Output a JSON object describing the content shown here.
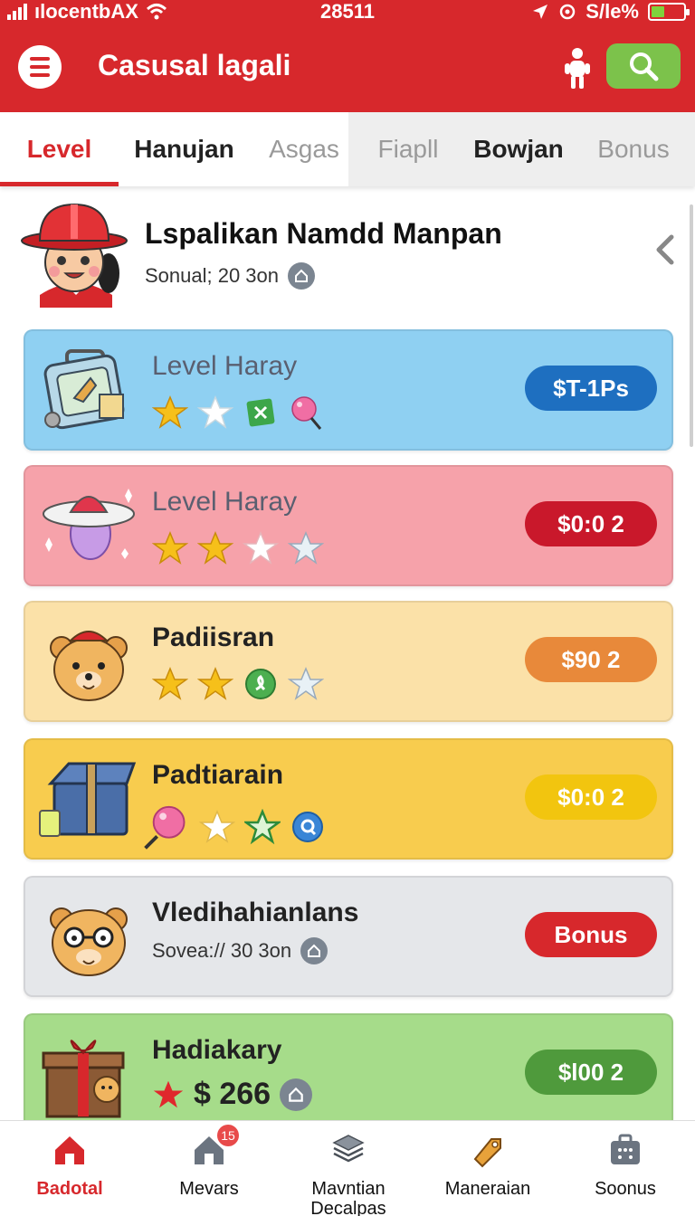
{
  "status_bar": {
    "carrier": "ılocentbAX",
    "time": "28511",
    "battery_text": "S/le%"
  },
  "header": {
    "title": "Casusal lagali",
    "menu_icon": "hamburger-menu-icon",
    "user_icon": "person-icon",
    "search_icon": "search-icon"
  },
  "tabs": [
    {
      "label": "Level",
      "active": true
    },
    {
      "label": "Hanujan",
      "active": false
    },
    {
      "label": "Asgas",
      "active": false
    },
    {
      "label": "Fiapll",
      "active": false
    },
    {
      "label": "Bowjan",
      "active": false
    },
    {
      "label": "Bonus",
      "active": false
    }
  ],
  "profile": {
    "name": "Lspalikan Namdd Manpan",
    "sub": "Sonual; 20 3on"
  },
  "cards": [
    {
      "title": "Level Haray",
      "price": "$T-1Ps",
      "bg": "#8fd0f2",
      "price_color": "#1e6fc0"
    },
    {
      "title": "Level Haray",
      "price": "$0:0 2",
      "bg": "#f6a2aa",
      "price_color": "#c9182b"
    },
    {
      "title": "Padiisran",
      "price": "$90 2",
      "bg": "#fbe1a8",
      "price_color": "#e8893a"
    },
    {
      "title": "Padtiarain",
      "price": "$0:0 2",
      "bg": "#f8cc4e",
      "price_color": "#f2c50f"
    },
    {
      "title": "Vledihahianlans",
      "sub": "Sovea:// 30 3on",
      "price": "Bonus",
      "bg": "#e5e7ea",
      "price_color": "#d7282c"
    },
    {
      "title": "Hadiakary",
      "amount": "$ 266",
      "price": "$l00 2",
      "bg": "#a6dc8a",
      "price_color": "#4f9a3c"
    }
  ],
  "bottom_nav": [
    {
      "label": "Badotal",
      "icon": "home-icon",
      "active": true
    },
    {
      "label": "Mevars",
      "icon": "house-icon",
      "badge": "15"
    },
    {
      "label": "Mavntian Decalpas",
      "icon": "layers-icon"
    },
    {
      "label": "Maneraian",
      "icon": "tag-icon"
    },
    {
      "label": "Soonus",
      "icon": "briefcase-icon"
    }
  ]
}
